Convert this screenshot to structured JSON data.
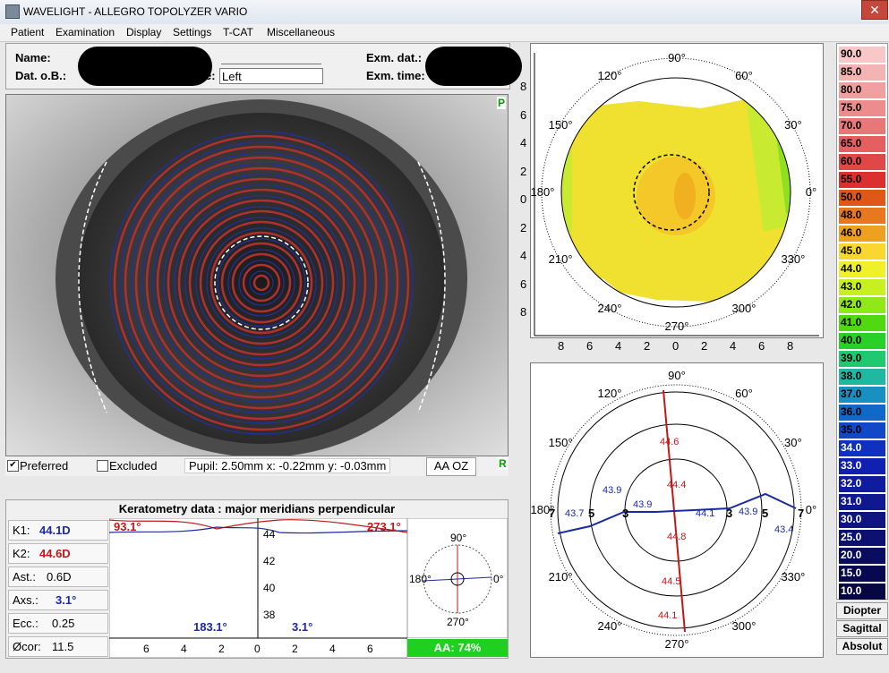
{
  "window": {
    "title": "WAVELIGHT  -  ALLEGRO TOPOLYZER VARIO",
    "close_glyph": "✕"
  },
  "menu": [
    "Patient",
    "Examination",
    "Display",
    "Settings",
    "T-CAT",
    "Miscellaneous"
  ],
  "patient": {
    "name_label": "Name:",
    "dob_label": "Dat. o.B.:",
    "eye_label_tail": "e:",
    "eye_value": "Left",
    "exam_date_label": "Exm. dat.:",
    "exam_time_label": "Exm. time:"
  },
  "image_panel": {
    "corner_top": "P",
    "corner_bottom": "R",
    "preferred_label": "Preferred",
    "preferred_checked": true,
    "excluded_label": "Excluded",
    "excluded_checked": false,
    "pupil_text": "Pupil: 2.50mm x: -0.22mm y: -0.03mm",
    "aa_oz_label": "AA OZ"
  },
  "keratometry": {
    "title": "Keratometry data : major meridians perpendicular",
    "k1_label": "K1:",
    "k1_value": "44.1D",
    "k2_label": "K2:",
    "k2_value": "44.6D",
    "ast_label": "Ast.:",
    "ast_value": "0.6D",
    "axs_label": "Axs.:",
    "axs_value": "3.1°",
    "ecc_label": "Ecc.:",
    "ecc_value": "0.25",
    "cor_label": "Øcor:",
    "cor_value": "11.5",
    "angle_top_left": "93.1°",
    "angle_top_right": "273.1°",
    "angle_bottom_left": "183.1°",
    "angle_bottom_right": "3.1°",
    "profile_y_ticks": [
      "44",
      "42",
      "40",
      "38"
    ],
    "profile_x_ticks": [
      "6",
      "4",
      "2",
      "0",
      "2",
      "4",
      "6"
    ],
    "mini_labels": {
      "top": "90°",
      "bottom": "270°",
      "left": "180°",
      "right": "0°"
    },
    "aa_text": "AA: 74%"
  },
  "topo_map": {
    "axis_ticks_y": [
      "8",
      "6",
      "4",
      "2",
      "0",
      "2",
      "4",
      "6",
      "8"
    ],
    "axis_ticks_x": [
      "8",
      "6",
      "4",
      "2",
      "0",
      "2",
      "4",
      "6",
      "8"
    ],
    "angles": [
      "90°",
      "60°",
      "30°",
      "0°",
      "330°",
      "300°",
      "270°",
      "240°",
      "210°",
      "180°",
      "150°",
      "120°"
    ]
  },
  "meridian_map": {
    "angles": [
      "90°",
      "60°",
      "30°",
      "0°",
      "330°",
      "300°",
      "270°",
      "240°",
      "210°",
      "180°",
      "150°",
      "120°"
    ],
    "zone_labels": [
      "7",
      "5",
      "3",
      "3",
      "5",
      "7"
    ],
    "values": {
      "v_top7": "44.6",
      "v_top3": "44.4",
      "v_bot3": "44.8",
      "v_bot5": "44.5",
      "v_bot7": "44.1",
      "h_left5": "43.9",
      "h_left7": "43.7",
      "h_left3": "43.9",
      "h_right3": "44.1",
      "h_right5": "43.9",
      "h_right7": "43.4"
    }
  },
  "legend": {
    "values": [
      "90.0",
      "85.0",
      "80.0",
      "75.0",
      "70.0",
      "65.0",
      "60.0",
      "55.0",
      "50.0",
      "48.0",
      "46.0",
      "45.0",
      "44.0",
      "43.0",
      "42.0",
      "41.0",
      "40.0",
      "39.0",
      "38.0",
      "37.0",
      "36.0",
      "35.0",
      "34.0",
      "33.0",
      "32.0",
      "31.0",
      "30.0",
      "25.0",
      "20.0",
      "15.0",
      "10.0"
    ],
    "colors": [
      "#f8c8c8",
      "#f4b4b4",
      "#f0a0a0",
      "#ec8c8c",
      "#e87878",
      "#e46060",
      "#e04848",
      "#dc3030",
      "#e05818",
      "#e87820",
      "#f0a020",
      "#f8d830",
      "#f0f028",
      "#c8f020",
      "#90e818",
      "#50d810",
      "#28d028",
      "#20c870",
      "#20b8a0",
      "#1890c0",
      "#1068c8",
      "#1048c8",
      "#1030c0",
      "#1020b0",
      "#101ca0",
      "#101890",
      "#101480",
      "#0c1070",
      "#0a0c60",
      "#080850",
      "#060640"
    ],
    "buttons": [
      "Diopter",
      "Sagittal",
      "Absolut"
    ]
  }
}
